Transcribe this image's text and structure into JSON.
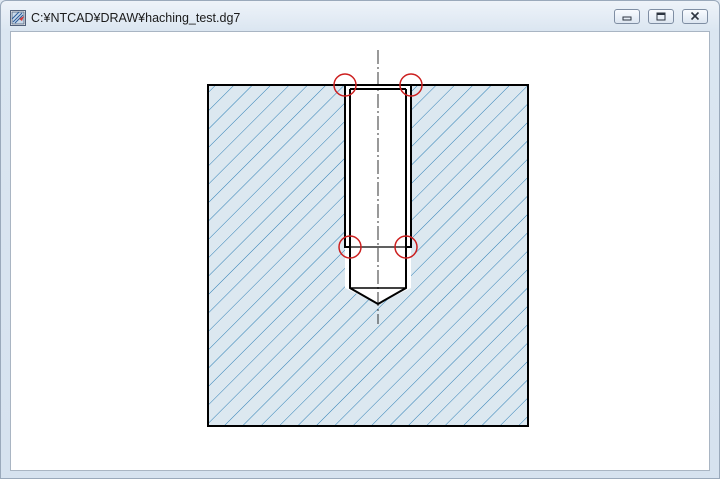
{
  "window": {
    "title": "C:¥NTCAD¥DRAW¥haching_test.dg7",
    "icon": "ntcad-drawing-icon"
  },
  "controls": {
    "minimize": "minimize-icon",
    "maximize": "maximize-icon",
    "close": "close-icon"
  },
  "drawing": {
    "hatch_color": "#2e7fb5",
    "hatch_background": "#dce8f0",
    "outline_color": "#000000",
    "marker_color": "#cc1f1f",
    "marker_count": 4
  }
}
